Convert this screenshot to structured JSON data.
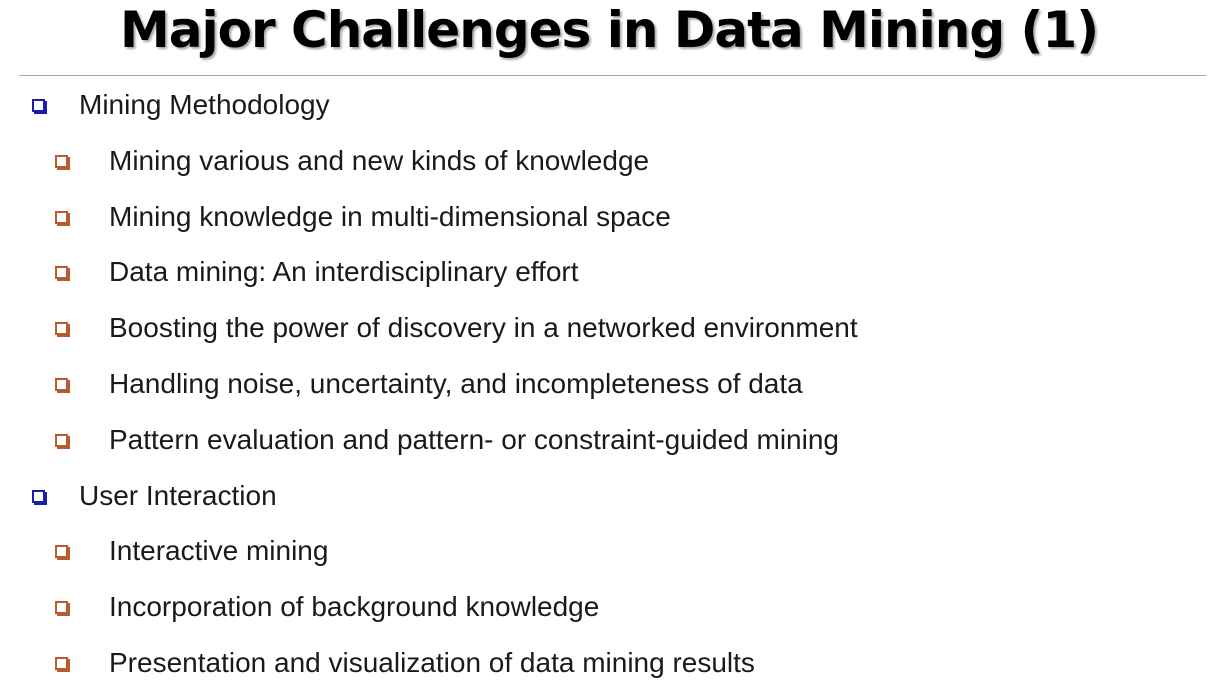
{
  "title": "Major Challenges in Data Mining (1)",
  "colors": {
    "level1_bullet": "#1b1bb0",
    "level2_bullet": "#b85c2e",
    "rule": "#a6a6a6"
  },
  "sections": [
    {
      "heading": "Mining Methodology",
      "items": [
        "Mining various and new kinds of knowledge",
        "Mining knowledge in multi-dimensional space",
        "Data mining: An interdisciplinary effort",
        "Boosting the power of discovery in a networked environment",
        "Handling noise, uncertainty, and incompleteness of data",
        "Pattern evaluation and pattern- or constraint-guided mining"
      ]
    },
    {
      "heading": "User Interaction",
      "items": [
        "Interactive mining",
        "Incorporation of background knowledge",
        "Presentation and visualization of data mining results"
      ]
    }
  ]
}
